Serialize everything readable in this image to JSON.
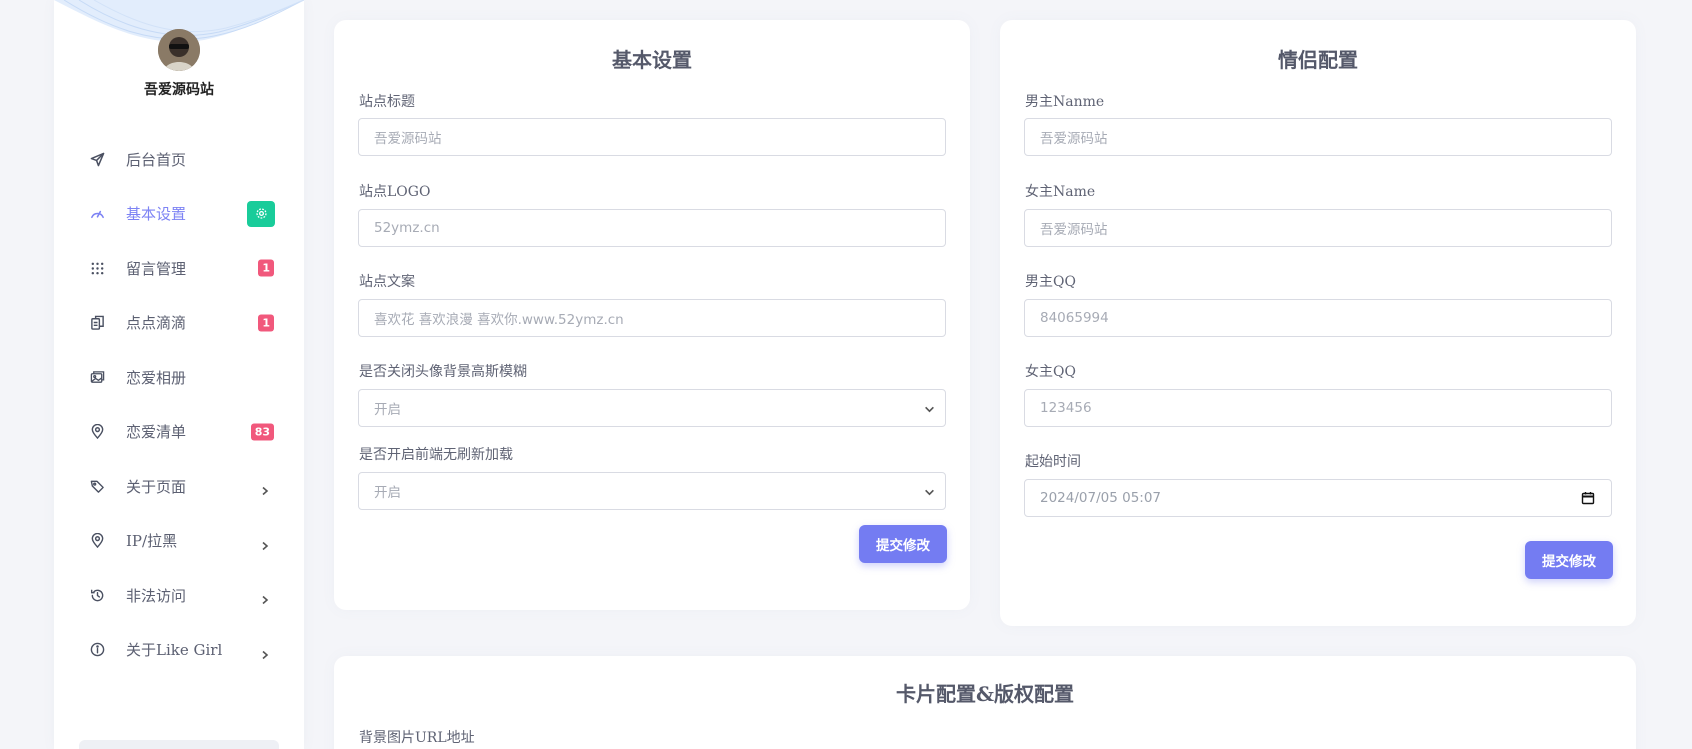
{
  "sidebar": {
    "site_name": "吾爱源码站",
    "items": [
      {
        "label": "后台首页",
        "icon": "send-icon"
      },
      {
        "label": "基本设置",
        "icon": "gauge-icon",
        "active": true,
        "indicator": "gear-badge-icon"
      },
      {
        "label": "留言管理",
        "icon": "grid-dots-icon",
        "badge": "1"
      },
      {
        "label": "点点滴滴",
        "icon": "copy-icon",
        "badge": "1"
      },
      {
        "label": "恋爱相册",
        "icon": "images-icon"
      },
      {
        "label": "恋爱清单",
        "icon": "map-pin-icon",
        "badge": "83"
      },
      {
        "label": "关于页面",
        "icon": "tag-icon",
        "chevron": true
      },
      {
        "label": "IP/拉黑",
        "icon": "location-icon",
        "chevron": true
      },
      {
        "label": "非法访问",
        "icon": "history-icon",
        "chevron": true
      },
      {
        "label": "关于Like Girl",
        "icon": "info-icon",
        "chevron": true
      }
    ]
  },
  "basic_settings": {
    "title": "基本设置",
    "site_title_label": "站点标题",
    "site_title_placeholder": "吾爱源码站",
    "site_logo_label": "站点LOGO",
    "site_logo_placeholder": "52ymz.cn",
    "site_copy_label": "站点文案",
    "site_copy_placeholder": "喜欢花 喜欢浪漫 喜欢你.www.52ymz.cn",
    "blur_label": "是否关闭头像背景高斯模糊",
    "blur_value": "开启",
    "noreload_label": "是否开启前端无刷新加载",
    "noreload_value": "开启",
    "submit_label": "提交修改"
  },
  "couple_settings": {
    "title": "情侣配置",
    "male_name_label": "男主Nanme",
    "male_name_placeholder": "吾爱源码站",
    "female_name_label": "女主Name",
    "female_name_placeholder": "吾爱源码站",
    "male_qq_label": "男主QQ",
    "male_qq_placeholder": "84065994",
    "female_qq_label": "女主QQ",
    "female_qq_placeholder": "123456",
    "start_time_label": "起始时间",
    "start_time_value": "2024/07/05 05:07",
    "submit_label": "提交修改"
  },
  "card_settings": {
    "title": "卡片配置&版权配置",
    "bg_url_label": "背景图片URL地址"
  },
  "colors": {
    "accent": "#747cf2",
    "active_nav": "#7d83f4",
    "badge_red": "#f1587c",
    "badge_green": "#19cc9a",
    "background": "#f4f5f9"
  }
}
